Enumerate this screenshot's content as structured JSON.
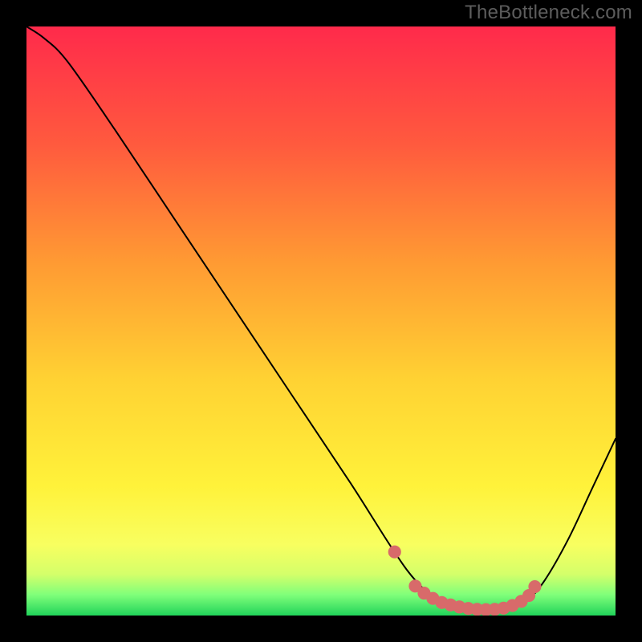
{
  "watermark": "TheBottleneck.com",
  "chart_data": {
    "type": "line",
    "title": "",
    "xlabel": "",
    "ylabel": "",
    "xlim": [
      0,
      100
    ],
    "ylim": [
      0,
      100
    ],
    "grid": false,
    "legend": false,
    "gradient_stops": [
      {
        "offset": 0.0,
        "color": "#ff2a4b"
      },
      {
        "offset": 0.2,
        "color": "#ff5a3e"
      },
      {
        "offset": 0.4,
        "color": "#ff9a33"
      },
      {
        "offset": 0.6,
        "color": "#ffd233"
      },
      {
        "offset": 0.78,
        "color": "#fff23a"
      },
      {
        "offset": 0.88,
        "color": "#f8ff60"
      },
      {
        "offset": 0.93,
        "color": "#d4ff6a"
      },
      {
        "offset": 0.965,
        "color": "#7fff7a"
      },
      {
        "offset": 1.0,
        "color": "#21d35a"
      }
    ],
    "curve": {
      "name": "bottleneck-curve",
      "color": "#000000",
      "x": [
        0.0,
        3.0,
        7.0,
        15.0,
        25.0,
        35.0,
        45.0,
        55.0,
        62.0,
        66.0,
        70.0,
        74.0,
        78.0,
        82.0,
        85.0,
        88.0,
        92.0,
        96.0,
        100.0
      ],
      "y": [
        100.0,
        98.0,
        94.0,
        82.5,
        67.5,
        52.5,
        37.5,
        22.5,
        11.5,
        6.0,
        2.5,
        1.3,
        1.0,
        1.2,
        2.5,
        6.0,
        13.0,
        21.5,
        30.0
      ]
    },
    "markers": {
      "name": "optimal-range",
      "color": "#d86a6a",
      "radius": 1.1,
      "x": [
        62.5,
        66.0,
        67.5,
        69.0,
        70.5,
        72.0,
        73.5,
        75.0,
        76.5,
        78.0,
        79.5,
        81.0,
        82.5,
        84.0,
        85.3,
        86.3
      ],
      "y": [
        10.8,
        5.0,
        3.8,
        2.9,
        2.2,
        1.8,
        1.45,
        1.2,
        1.05,
        1.0,
        1.05,
        1.25,
        1.7,
        2.4,
        3.4,
        4.9
      ]
    }
  }
}
